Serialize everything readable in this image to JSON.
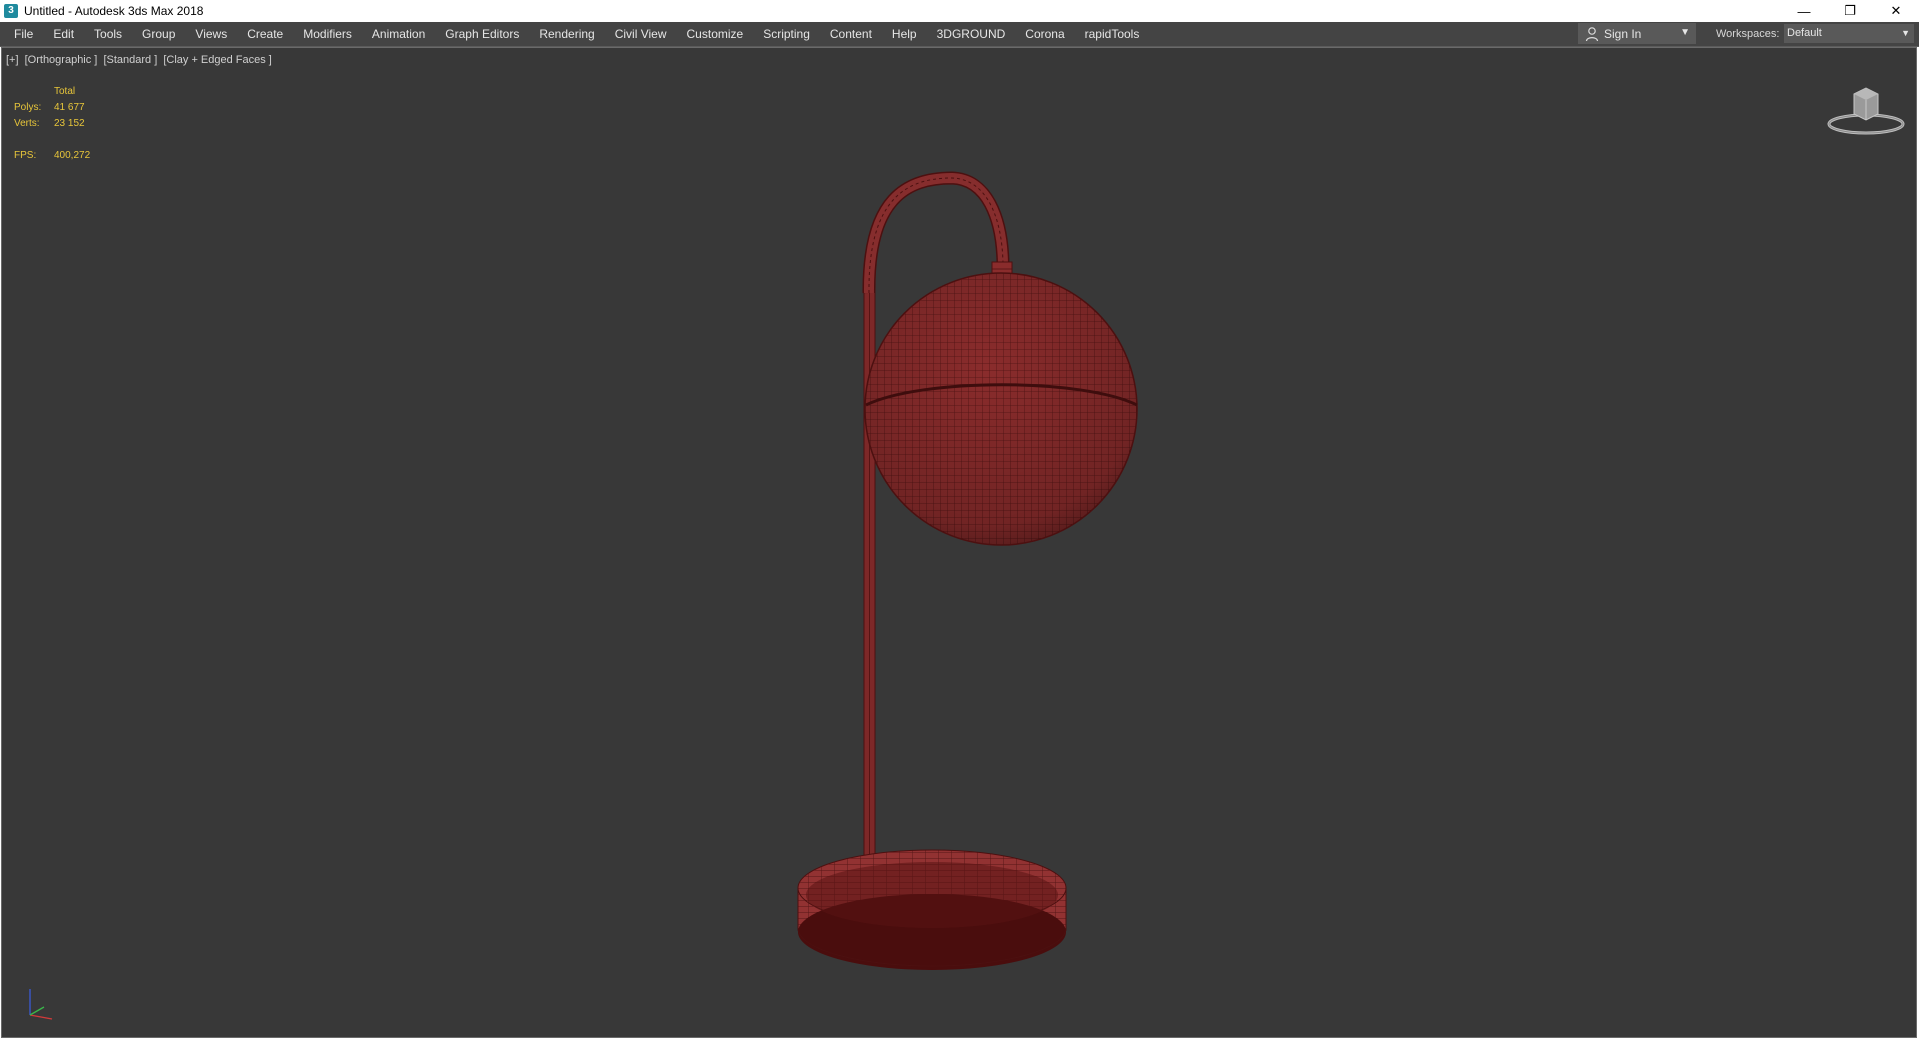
{
  "window": {
    "title": "Untitled - Autodesk 3ds Max 2018",
    "app_icon": "3",
    "controls": {
      "minimize": "—",
      "restore": "❐",
      "close": "✕"
    }
  },
  "menubar": {
    "items": [
      {
        "label": "File"
      },
      {
        "label": "Edit"
      },
      {
        "label": "Tools"
      },
      {
        "label": "Group"
      },
      {
        "label": "Views"
      },
      {
        "label": "Create"
      },
      {
        "label": "Modifiers"
      },
      {
        "label": "Animation"
      },
      {
        "label": "Graph Editors"
      },
      {
        "label": "Rendering"
      },
      {
        "label": "Civil View"
      },
      {
        "label": "Customize"
      },
      {
        "label": "Scripting"
      },
      {
        "label": "Content"
      },
      {
        "label": "Help"
      },
      {
        "label": "3DGROUND"
      },
      {
        "label": "Corona"
      },
      {
        "label": "rapidTools"
      }
    ],
    "sign_in": "Sign In",
    "workspaces_label": "Workspaces:",
    "workspace_value": "Default"
  },
  "viewport": {
    "label_parts": [
      "[+]",
      "[Orthographic ]",
      "[Standard ]",
      "[Clay + Edged Faces ]"
    ],
    "stats": {
      "header": "Total",
      "polys_label": "Polys:",
      "polys_value": "41 677",
      "verts_label": "Verts:",
      "verts_value": "23 152",
      "fps_label": "FPS:",
      "fps_value": "400,272"
    },
    "viewcube_icon": "viewcube-icon",
    "axis_icon": "axis-tripod-icon"
  },
  "colors": {
    "viewport_bg": "#383838",
    "menubar_bg": "#444444",
    "stats_text": "#e8c63a",
    "model_clay": "#8b2e2e",
    "model_wire": "#5a1414"
  }
}
